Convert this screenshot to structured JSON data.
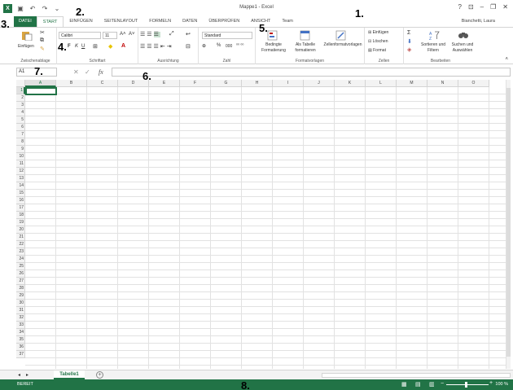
{
  "window": {
    "title": "Mappe1 - Excel",
    "user": "Bianchetti, Laura",
    "help": "?",
    "ctrl_minimize": "–",
    "ctrl_restore": "❐",
    "ctrl_close": "✕",
    "ctrl_ribbon": "⊡"
  },
  "tabs": [
    "DATEI",
    "START",
    "EINFÜGEN",
    "SEITENLAYOUT",
    "FORMELN",
    "DATEN",
    "ÜBERPRÜFEN",
    "ANSICHT",
    "Team"
  ],
  "ribbon": {
    "clipboard": {
      "label": "Zwischenablage",
      "paste": "Einfügen"
    },
    "font": {
      "label": "Schriftart",
      "name": "Calibri",
      "size": "11",
      "bold": "F",
      "italic": "K",
      "underline": "U"
    },
    "alignment": {
      "label": "Ausrichtung"
    },
    "number": {
      "label": "Zahl",
      "format": "Standard"
    },
    "styles": {
      "label": "Formatvorlagen",
      "conditional": "Bedingte Formatierung",
      "table": "Als Tabelle formatieren",
      "cellstyles": "Zellenformatvorlagen"
    },
    "cells": {
      "label": "Zellen",
      "insert": "Einfügen",
      "delete": "Löschen",
      "format": "Format"
    },
    "editing": {
      "label": "Bearbeiten",
      "sort": "Sortieren und Filtern",
      "find": "Suchen und Auswählen"
    }
  },
  "formula_bar": {
    "name_box": "A1",
    "fx": "fx"
  },
  "grid": {
    "columns": [
      "A",
      "B",
      "C",
      "D",
      "E",
      "F",
      "G",
      "H",
      "I",
      "J",
      "K",
      "L",
      "M",
      "N",
      "O"
    ],
    "rows": [
      "1",
      "2",
      "3",
      "4",
      "5",
      "6",
      "7",
      "8",
      "9",
      "10",
      "11",
      "12",
      "13",
      "14",
      "15",
      "16",
      "17",
      "18",
      "19",
      "20",
      "21",
      "22",
      "23",
      "24",
      "25",
      "26",
      "27",
      "28",
      "29",
      "30",
      "31",
      "32",
      "33",
      "34",
      "35",
      "36",
      "37"
    ]
  },
  "sheet": {
    "tab": "Tabelle1",
    "add": "+"
  },
  "status": {
    "text": "BEREIT",
    "zoom": "100 %"
  },
  "annotations": [
    "1.",
    "2.",
    "3.",
    "4.",
    "5.",
    "6.",
    "7.",
    "8."
  ],
  "colors": {
    "accent": "#217346"
  }
}
